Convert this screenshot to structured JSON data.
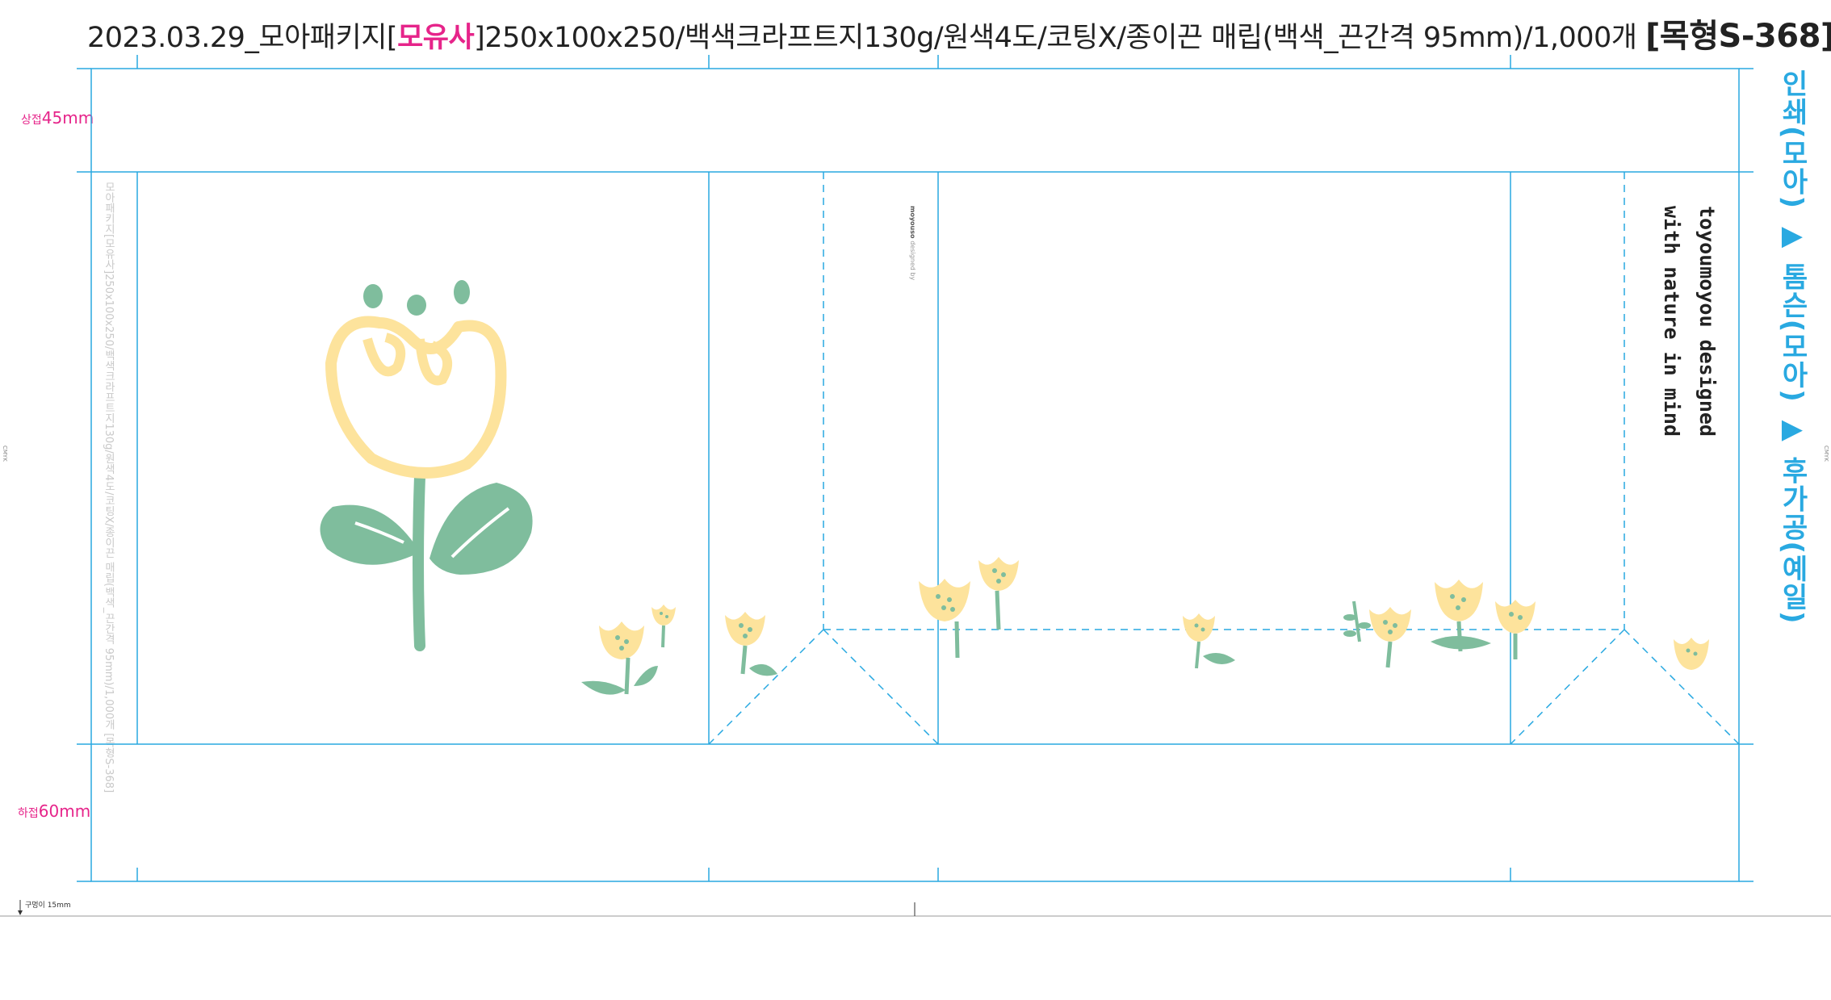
{
  "header": {
    "prefix": "2023.03.29_모아패키지[",
    "client": "모유사",
    "spec": "]250x100x250/백색크라프트지130g/원색4도/코팅X/종이끈 매립(백색_끈간격 95mm)/1,000개",
    "mold": "[목형S-368]"
  },
  "margins": {
    "top_label": "상접",
    "top_value": "45mm",
    "bottom_label": "하접",
    "bottom_value": "60mm"
  },
  "process_flow": "인쇄(모아) ▶ 톰슨(모아) ▶ 후가공(예일)",
  "slogan": {
    "line1": "toyoumoyou designed",
    "line2": "with nature in mind"
  },
  "spec_vertical": "모아패키지[모유사]250x100x250/백색크라프트지130g/원색4도/코팅X/종이끈 매립(백색_끈간격 95mm)/1,000개 [목형S-368]",
  "brand": {
    "name": "moyouso",
    "sub": "designed by"
  },
  "handle_label": "구멍이 15mm",
  "cmyk_label": "CMYK",
  "colors": {
    "cut_line": "#29a9e1",
    "margin_label": "#e6248a",
    "process_text": "#29a9e1",
    "flower_yellow": "#fde39c",
    "leaf_green": "#7fbd9d"
  },
  "artwork": {
    "main_motif": "tulip-illustration",
    "small_motif": "small-yellow-flower"
  }
}
